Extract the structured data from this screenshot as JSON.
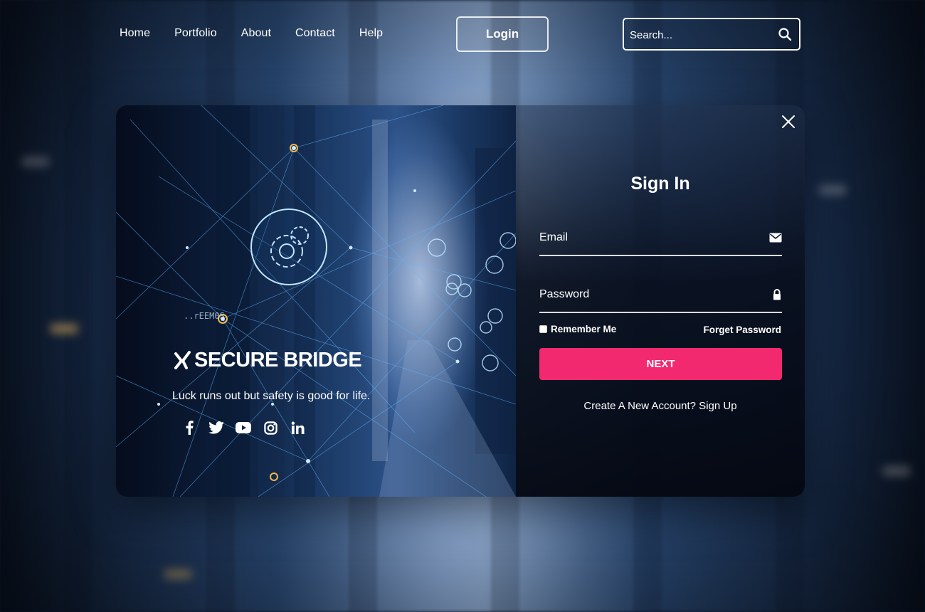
{
  "nav": {
    "links": [
      "Home",
      "Portfolio",
      "About",
      "Contact",
      "Help"
    ],
    "login_label": "Login",
    "search_placeholder": "Search..."
  },
  "brand": {
    "name": "SECURE BRIDGE",
    "tagline": "Luck runs out but safety is good for life.",
    "socials": [
      "facebook-icon",
      "twitter-icon",
      "youtube-icon",
      "instagram-icon",
      "linkedin-icon"
    ]
  },
  "signin": {
    "title": "Sign In",
    "email_placeholder": "Email",
    "password_placeholder": "Password",
    "remember_label": "Remember Me",
    "forget_label": "Forget Password",
    "next_label": "NEXT",
    "create_label": "Create A New Account? Sign Up"
  },
  "colors": {
    "accent": "#f2296f",
    "text": "#ffffff"
  }
}
